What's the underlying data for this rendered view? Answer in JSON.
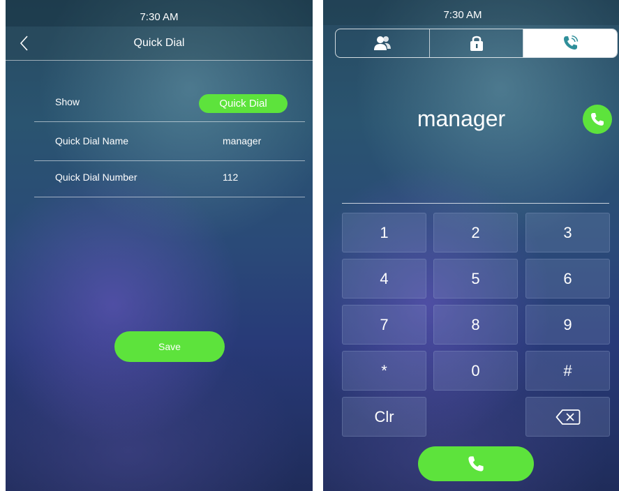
{
  "settings_screen": {
    "status_time": "7:30 AM",
    "title": "Quick Dial",
    "rows": [
      {
        "label": "Show",
        "value": "Quick Dial"
      },
      {
        "label": "Quick Dial Name",
        "value": "manager"
      },
      {
        "label": "Quick Dial Number",
        "value": "112"
      }
    ],
    "save_label": "Save"
  },
  "dial_screen": {
    "status_time": "7:30 AM",
    "tabs": [
      {
        "icon": "contacts-icon",
        "selected": false
      },
      {
        "icon": "lock-icon",
        "selected": false
      },
      {
        "icon": "phone-call-icon",
        "selected": true
      }
    ],
    "dial_name": "manager",
    "keypad": [
      "1",
      "2",
      "3",
      "4",
      "5",
      "6",
      "7",
      "8",
      "9",
      "*",
      "0",
      "#",
      "Clr",
      "",
      "backspace-icon"
    ]
  },
  "colors": {
    "accent_green": "#5de33c",
    "selected_tab_bg": "#ffffff",
    "selected_tab_icon": "#2f8f9a"
  }
}
